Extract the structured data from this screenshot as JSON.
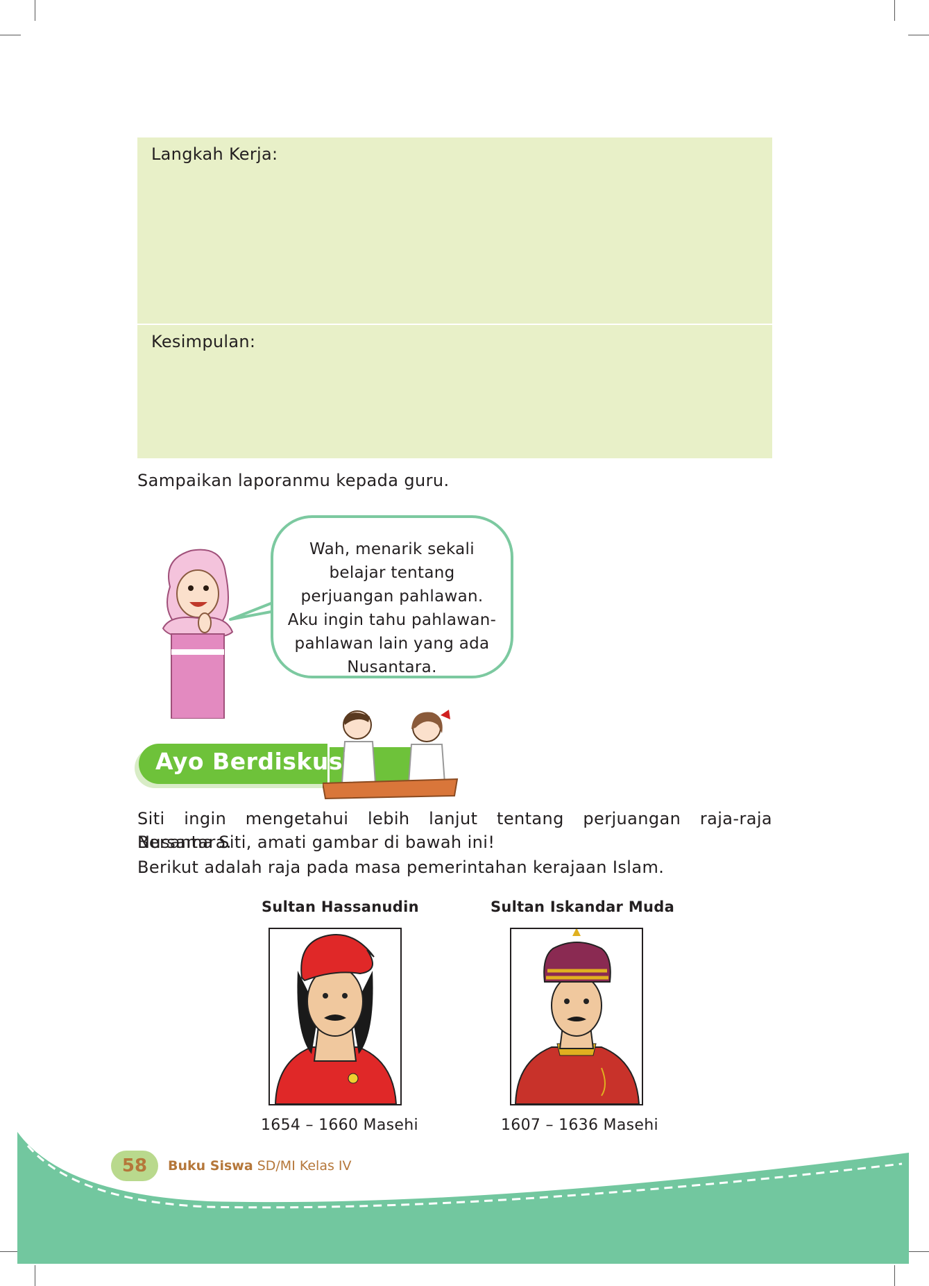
{
  "task_table": {
    "steps_label": "Langkah Kerja:",
    "conclusion_label": "Kesimpulan:"
  },
  "instruction": "Sampaikan laporanmu kepada guru.",
  "speech_bubble": {
    "lines": [
      "Wah, menarik sekali",
      "belajar tentang",
      "perjuangan pahlawan.",
      "Aku ingin tahu pahlawan-",
      "pahlawan lain yang ada",
      "Nusantara."
    ]
  },
  "section": {
    "title": "Ayo Berdiskusi"
  },
  "paragraphs": [
    "Siti ingin mengetahui lebih lanjut tentang perjuangan raja-raja Nusantara.",
    "Bersama Siti, amati gambar di bawah ini!",
    "Berikut adalah raja pada masa pemerintahan kerajaan Islam."
  ],
  "portraits": [
    {
      "name": "Sultan Hassanudin",
      "period": "1654 – 1660 Masehi"
    },
    {
      "name": "Sultan Iskandar Muda",
      "period": "1607 – 1636 Masehi"
    }
  ],
  "footer": {
    "page_number": "58",
    "book_bold": "Buku Siswa",
    "book_rest": " SD/MI Kelas IV"
  },
  "colors": {
    "task_box": "#e8f0c8",
    "bubble_border": "#7cc9a0",
    "section_pill": "#6ec23a",
    "footer_wave": "#72c79f",
    "footer_text": "#b5773a"
  },
  "icons": [
    "girl-hijab-illustration",
    "kids-discussing-illustration",
    "sultan-hassanudin-portrait",
    "sultan-iskandar-muda-portrait"
  ]
}
